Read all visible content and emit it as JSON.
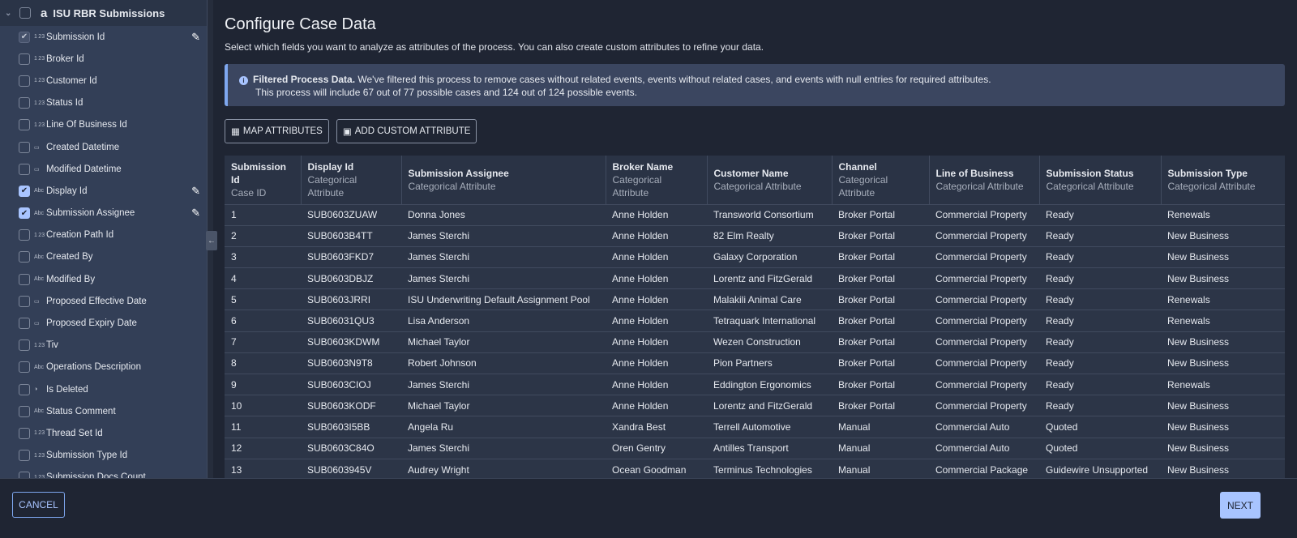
{
  "sidebar": {
    "title": "ISU RBR Submissions",
    "items": [
      {
        "label": "Submission Id",
        "type": "123",
        "state": "disabled",
        "edit": true
      },
      {
        "label": "Broker Id",
        "type": "123",
        "state": "off"
      },
      {
        "label": "Customer Id",
        "type": "123",
        "state": "off"
      },
      {
        "label": "Status Id",
        "type": "123",
        "state": "off"
      },
      {
        "label": "Line Of Business Id",
        "type": "123",
        "state": "off"
      },
      {
        "label": "Created Datetime",
        "type": "date",
        "state": "off"
      },
      {
        "label": "Modified Datetime",
        "type": "date",
        "state": "off"
      },
      {
        "label": "Display Id",
        "type": "Abc",
        "state": "on",
        "edit": true
      },
      {
        "label": "Submission Assignee",
        "type": "Abc",
        "state": "on",
        "edit": true
      },
      {
        "label": "Creation Path Id",
        "type": "123",
        "state": "off"
      },
      {
        "label": "Created By",
        "type": "Abc",
        "state": "off"
      },
      {
        "label": "Modified By",
        "type": "Abc",
        "state": "off"
      },
      {
        "label": "Proposed Effective Date",
        "type": "date",
        "state": "off"
      },
      {
        "label": "Proposed Expiry Date",
        "type": "date",
        "state": "off"
      },
      {
        "label": "Tiv",
        "type": "123",
        "state": "off"
      },
      {
        "label": "Operations Description",
        "type": "Abc",
        "state": "off"
      },
      {
        "label": "Is Deleted",
        "type": "bool",
        "state": "off"
      },
      {
        "label": "Status Comment",
        "type": "Abc",
        "state": "off"
      },
      {
        "label": "Thread Set Id",
        "type": "123",
        "state": "off"
      },
      {
        "label": "Submission Type Id",
        "type": "123",
        "state": "off"
      },
      {
        "label": "Submission Docs Count",
        "type": "123",
        "state": "off"
      }
    ]
  },
  "main": {
    "title": "Configure Case Data",
    "subtitle": "Select which fields you want to analyze as attributes of the process. You can also create custom attributes to refine your data.",
    "alert": {
      "bold": "Filtered Process Data.",
      "line1": " We've filtered this process to remove cases without related events, events without related cases, and events with null entries for required attributes.",
      "line2": "This process will include 67 out of 77 possible cases and 124 out of 124 possible events."
    },
    "map_attributes": "MAP ATTRIBUTES",
    "add_custom_attribute": "ADD CUSTOM ATTRIBUTE"
  },
  "table": {
    "columns": [
      {
        "title": "Submission Id",
        "sub": "Case ID"
      },
      {
        "title": "Display Id",
        "sub": "Categorical Attribute"
      },
      {
        "title": "Submission Assignee",
        "sub": "Categorical Attribute"
      },
      {
        "title": "Broker Name",
        "sub": "Categorical Attribute"
      },
      {
        "title": "Customer Name",
        "sub": "Categorical Attribute"
      },
      {
        "title": "Channel",
        "sub": "Categorical Attribute"
      },
      {
        "title": "Line of Business",
        "sub": "Categorical Attribute"
      },
      {
        "title": "Submission Status",
        "sub": "Categorical Attribute"
      },
      {
        "title": "Submission Type",
        "sub": "Categorical Attribute"
      }
    ],
    "rows": [
      [
        "1",
        "SUB0603ZUAW",
        "Donna Jones",
        "Anne Holden",
        "Transworld Consortium",
        "Broker Portal",
        "Commercial Property",
        "Ready",
        "Renewals"
      ],
      [
        "2",
        "SUB0603B4TT",
        "James Sterchi",
        "Anne Holden",
        "82 Elm Realty",
        "Broker Portal",
        "Commercial Property",
        "Ready",
        "New Business"
      ],
      [
        "3",
        "SUB0603FKD7",
        "James Sterchi",
        "Anne Holden",
        "Galaxy Corporation",
        "Broker Portal",
        "Commercial Property",
        "Ready",
        "New Business"
      ],
      [
        "4",
        "SUB0603DBJZ",
        "James Sterchi",
        "Anne Holden",
        "Lorentz and FitzGerald",
        "Broker Portal",
        "Commercial Property",
        "Ready",
        "New Business"
      ],
      [
        "5",
        "SUB0603JRRI",
        "ISU Underwriting Default Assignment Pool",
        "Anne Holden",
        "Malakili Animal Care",
        "Broker Portal",
        "Commercial Property",
        "Ready",
        "Renewals"
      ],
      [
        "6",
        "SUB06031QU3",
        "Lisa Anderson",
        "Anne Holden",
        "Tetraquark International",
        "Broker Portal",
        "Commercial Property",
        "Ready",
        "Renewals"
      ],
      [
        "7",
        "SUB0603KDWM",
        "Michael Taylor",
        "Anne Holden",
        "Wezen Construction",
        "Broker Portal",
        "Commercial Property",
        "Ready",
        "New Business"
      ],
      [
        "8",
        "SUB0603N9T8",
        "Robert Johnson",
        "Anne Holden",
        "Pion Partners",
        "Broker Portal",
        "Commercial Property",
        "Ready",
        "New Business"
      ],
      [
        "9",
        "SUB0603CIOJ",
        "James Sterchi",
        "Anne Holden",
        "Eddington Ergonomics",
        "Broker Portal",
        "Commercial Property",
        "Ready",
        "Renewals"
      ],
      [
        "10",
        "SUB0603KODF",
        "Michael Taylor",
        "Anne Holden",
        "Lorentz and FitzGerald",
        "Broker Portal",
        "Commercial Property",
        "Ready",
        "New Business"
      ],
      [
        "11",
        "SUB0603I5BB",
        "Angela Ru",
        "Xandra Best",
        "Terrell Automotive",
        "Manual",
        "Commercial Auto",
        "Quoted",
        "New Business"
      ],
      [
        "12",
        "SUB0603C84O",
        "James Sterchi",
        "Oren Gentry",
        "Antilles Transport",
        "Manual",
        "Commercial Auto",
        "Quoted",
        "New Business"
      ],
      [
        "13",
        "SUB0603945V",
        "Audrey Wright",
        "Ocean Goodman",
        "Terminus Technologies",
        "Manual",
        "Commercial Package",
        "Guidewire Unsupported",
        "New Business"
      ]
    ]
  },
  "footer": {
    "cancel": "CANCEL",
    "next": "NEXT"
  },
  "colors": {
    "accent": "#a8c4ff",
    "sidebar": "#333f57",
    "background": "#1f2533"
  }
}
